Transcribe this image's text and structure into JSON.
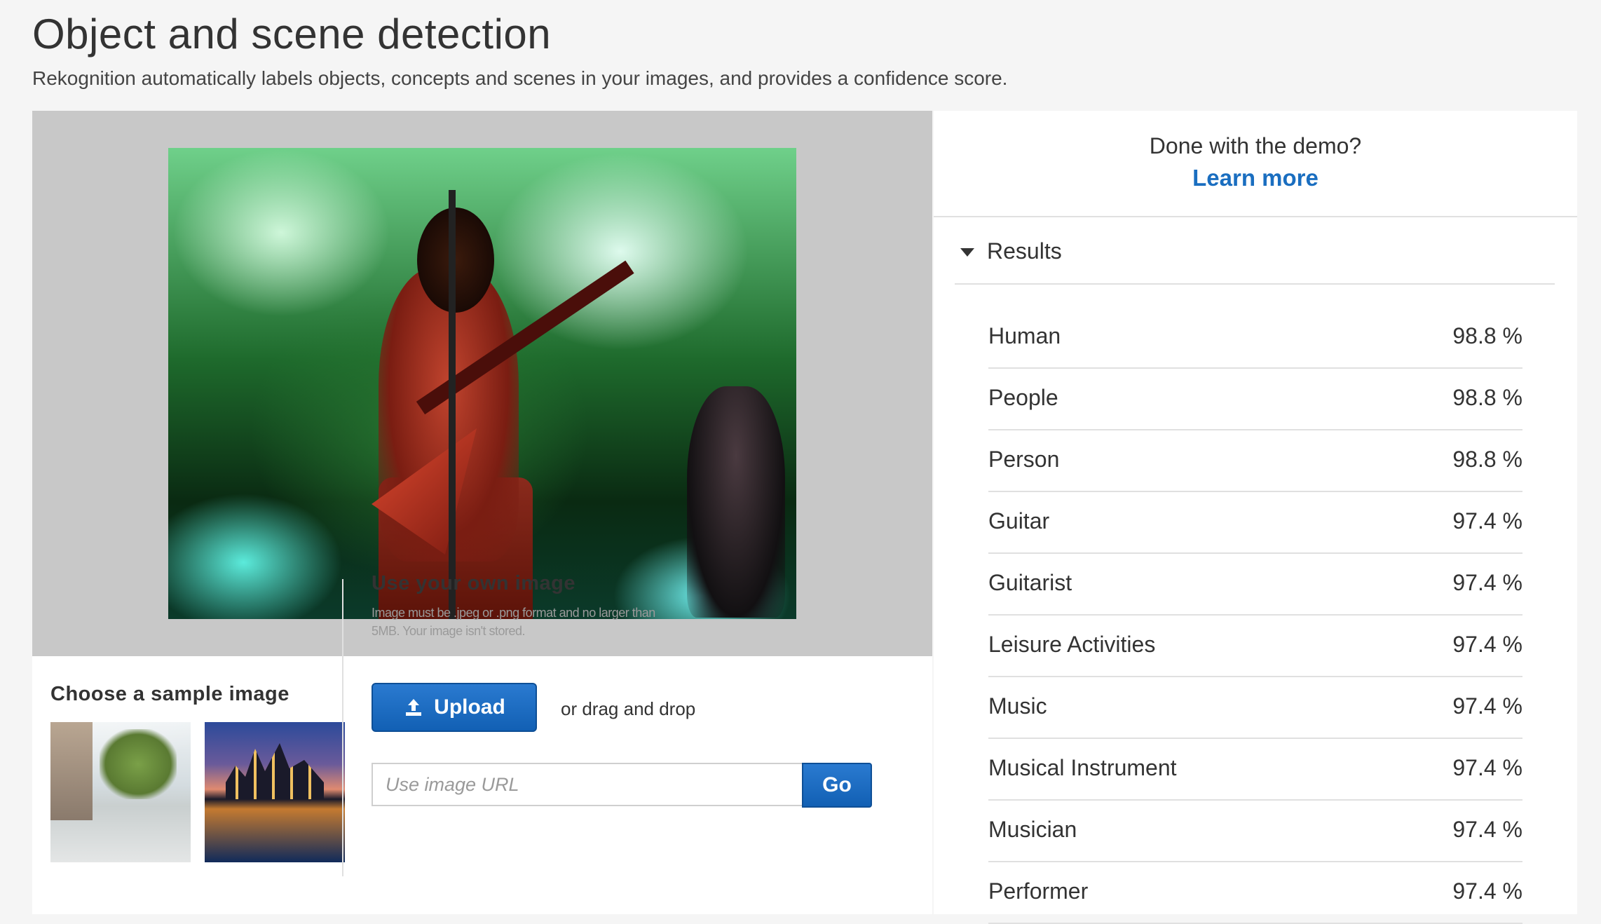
{
  "page": {
    "title": "Object and scene detection",
    "subtitle": "Rekognition automatically labels objects, concepts and scenes in your images, and provides a confidence score."
  },
  "samples": {
    "heading": "Choose a sample image"
  },
  "own_image": {
    "heading": "Use your own image",
    "help": "Image must be .jpeg or .png format and no larger than 5MB. Your image isn't stored.",
    "upload_label": "Upload",
    "drag_text": "or drag and drop",
    "url_placeholder": "Use image URL",
    "go_label": "Go"
  },
  "demo": {
    "question": "Done with the demo?",
    "learn_more": "Learn more"
  },
  "results": {
    "title": "Results",
    "items": [
      {
        "label": "Human",
        "confidence": "98.8 %"
      },
      {
        "label": "People",
        "confidence": "98.8 %"
      },
      {
        "label": "Person",
        "confidence": "98.8 %"
      },
      {
        "label": "Guitar",
        "confidence": "97.4 %"
      },
      {
        "label": "Guitarist",
        "confidence": "97.4 %"
      },
      {
        "label": "Leisure Activities",
        "confidence": "97.4 %"
      },
      {
        "label": "Music",
        "confidence": "97.4 %"
      },
      {
        "label": "Musical Instrument",
        "confidence": "97.4 %"
      },
      {
        "label": "Musician",
        "confidence": "97.4 %"
      },
      {
        "label": "Performer",
        "confidence": "97.4 %"
      }
    ]
  },
  "colors": {
    "accent": "#1a6ec0",
    "button": "#1a6cc4",
    "preview_bg": "#c8c8c8",
    "page_bg": "#f5f5f5"
  },
  "icons": {
    "upload": "upload-icon",
    "results_toggle": "caret-down-icon"
  }
}
